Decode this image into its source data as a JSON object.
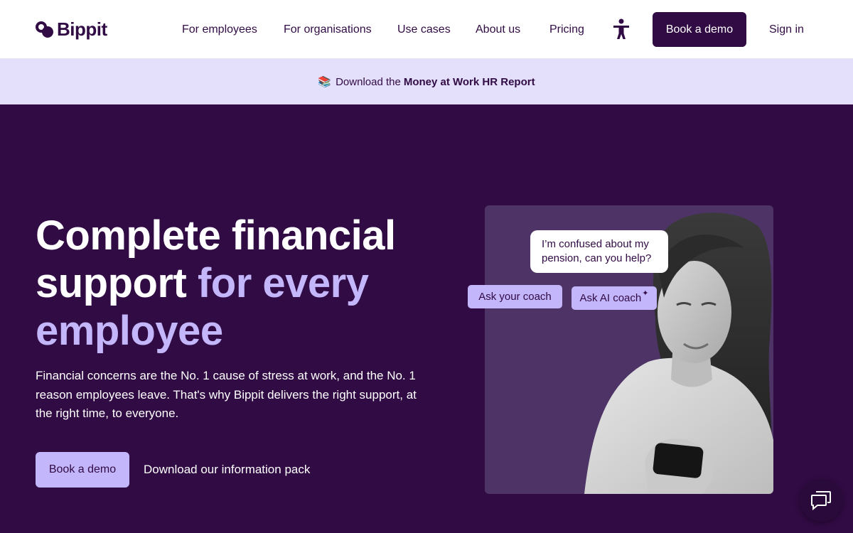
{
  "header": {
    "logo_text": "Bippit",
    "nav": [
      {
        "label": "For employees"
      },
      {
        "label": "For organisations"
      },
      {
        "label": "Use cases"
      },
      {
        "label": "About us"
      },
      {
        "label": "Pricing"
      }
    ],
    "accessibility_icon": "accessibility-person-icon",
    "book_demo_label": "Book a demo",
    "sign_in_label": "Sign in"
  },
  "banner": {
    "icon": "books-icon",
    "prefix": "Download the",
    "bold": "Money at Work HR Report"
  },
  "hero": {
    "title_line1": "Complete financial",
    "title_line2_white": "support",
    "title_line2_accent": "for every",
    "title_line3_accent": "employee",
    "subtitle": "Financial concerns are the No. 1 cause of stress at work, and the No. 1 reason employees leave. That's why Bippit delivers the right support, at the right time, to everyone.",
    "cta_primary": "Book a demo",
    "cta_secondary": "Download our information pack"
  },
  "visual": {
    "chat_bubble": "I’m confused about my pension, can you help?",
    "chip_coach": "Ask your coach",
    "chip_ai_coach": "Ask AI coach",
    "chip_ai_icon": "sparkle-icon"
  },
  "chat_launcher": {
    "icon": "chat-bubbles-icon"
  },
  "colors": {
    "brand_dark": "#310b44",
    "brand_light": "#c4b6fb",
    "banner_bg": "#e4e0fb"
  }
}
